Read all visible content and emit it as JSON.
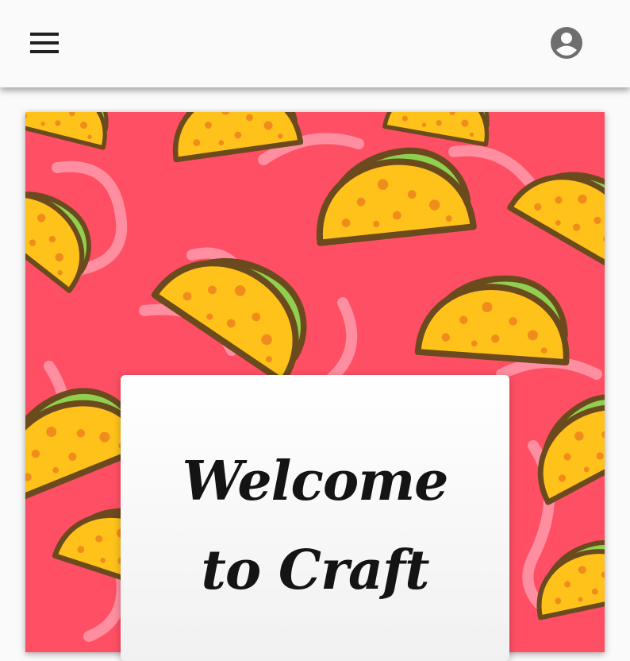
{
  "app_bar": {
    "menu_icon": "hamburger-menu-icon",
    "account_icon": "account-circle-icon"
  },
  "hero": {
    "background_pattern": "taco-pattern",
    "background_color": "#ff4f64"
  },
  "welcome_card": {
    "line1": "Welcome",
    "line2": "to Craft"
  },
  "colors": {
    "taco_shell": "#ffc21a",
    "taco_outline": "#6b4a1e",
    "lettuce": "#8fd14f",
    "squiggle": "#ff8ea0",
    "icon_gray": "#6e6e6e"
  }
}
